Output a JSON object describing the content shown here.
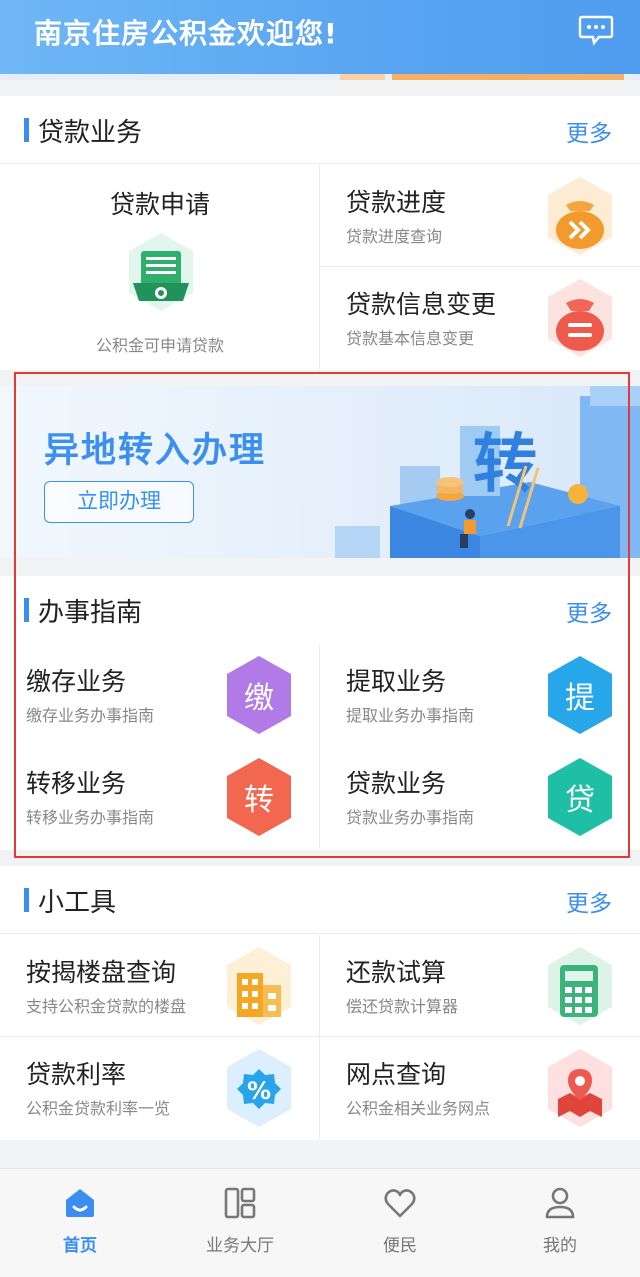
{
  "header": {
    "title": "南京住房公积金欢迎您!",
    "message_icon": "chat-bubble-icon"
  },
  "loan": {
    "title": "贷款业务",
    "more": "更多",
    "apply": {
      "title": "贷款申请",
      "subtitle": "公积金可申请贷款",
      "icon": "loan-document-icon"
    },
    "progress": {
      "title": "贷款进度",
      "subtitle": "贷款进度查询",
      "icon": "progress-arrows-icon"
    },
    "change": {
      "title": "贷款信息变更",
      "subtitle": "贷款基本信息变更",
      "icon": "money-bag-icon"
    }
  },
  "banner": {
    "title": "异地转入办理",
    "button": "立即办理",
    "art_char": "转"
  },
  "guide": {
    "title": "办事指南",
    "more": "更多",
    "items": [
      {
        "title": "缴存业务",
        "subtitle": "缴存业务办事指南",
        "badge": "缴",
        "color": "#b17ae6"
      },
      {
        "title": "提取业务",
        "subtitle": "提取业务办事指南",
        "badge": "提",
        "color": "#27a6ea"
      },
      {
        "title": "转移业务",
        "subtitle": "转移业务办事指南",
        "badge": "转",
        "color": "#f2674f"
      },
      {
        "title": "贷款业务",
        "subtitle": "贷款业务办事指南",
        "badge": "贷",
        "color": "#1fbfa6"
      }
    ]
  },
  "tools": {
    "title": "小工具",
    "more": "更多",
    "items": [
      {
        "title": "按揭楼盘查询",
        "subtitle": "支持公积金贷款的楼盘",
        "icon": "building-icon"
      },
      {
        "title": "还款试算",
        "subtitle": "偿还贷款计算器",
        "icon": "calculator-icon"
      },
      {
        "title": "贷款利率",
        "subtitle": "公积金贷款利率一览",
        "icon": "percent-badge-icon"
      },
      {
        "title": "网点查询",
        "subtitle": "公积金相关业务网点",
        "icon": "map-pin-icon"
      }
    ]
  },
  "nav": [
    {
      "label": "首页",
      "icon": "home-icon",
      "active": true
    },
    {
      "label": "业务大厅",
      "icon": "grid-icon",
      "active": false
    },
    {
      "label": "便民",
      "icon": "heart-icon",
      "active": false
    },
    {
      "label": "我的",
      "icon": "user-icon",
      "active": false
    }
  ],
  "colors": {
    "accent": "#3a8ef0",
    "highlight": "#e53935"
  }
}
